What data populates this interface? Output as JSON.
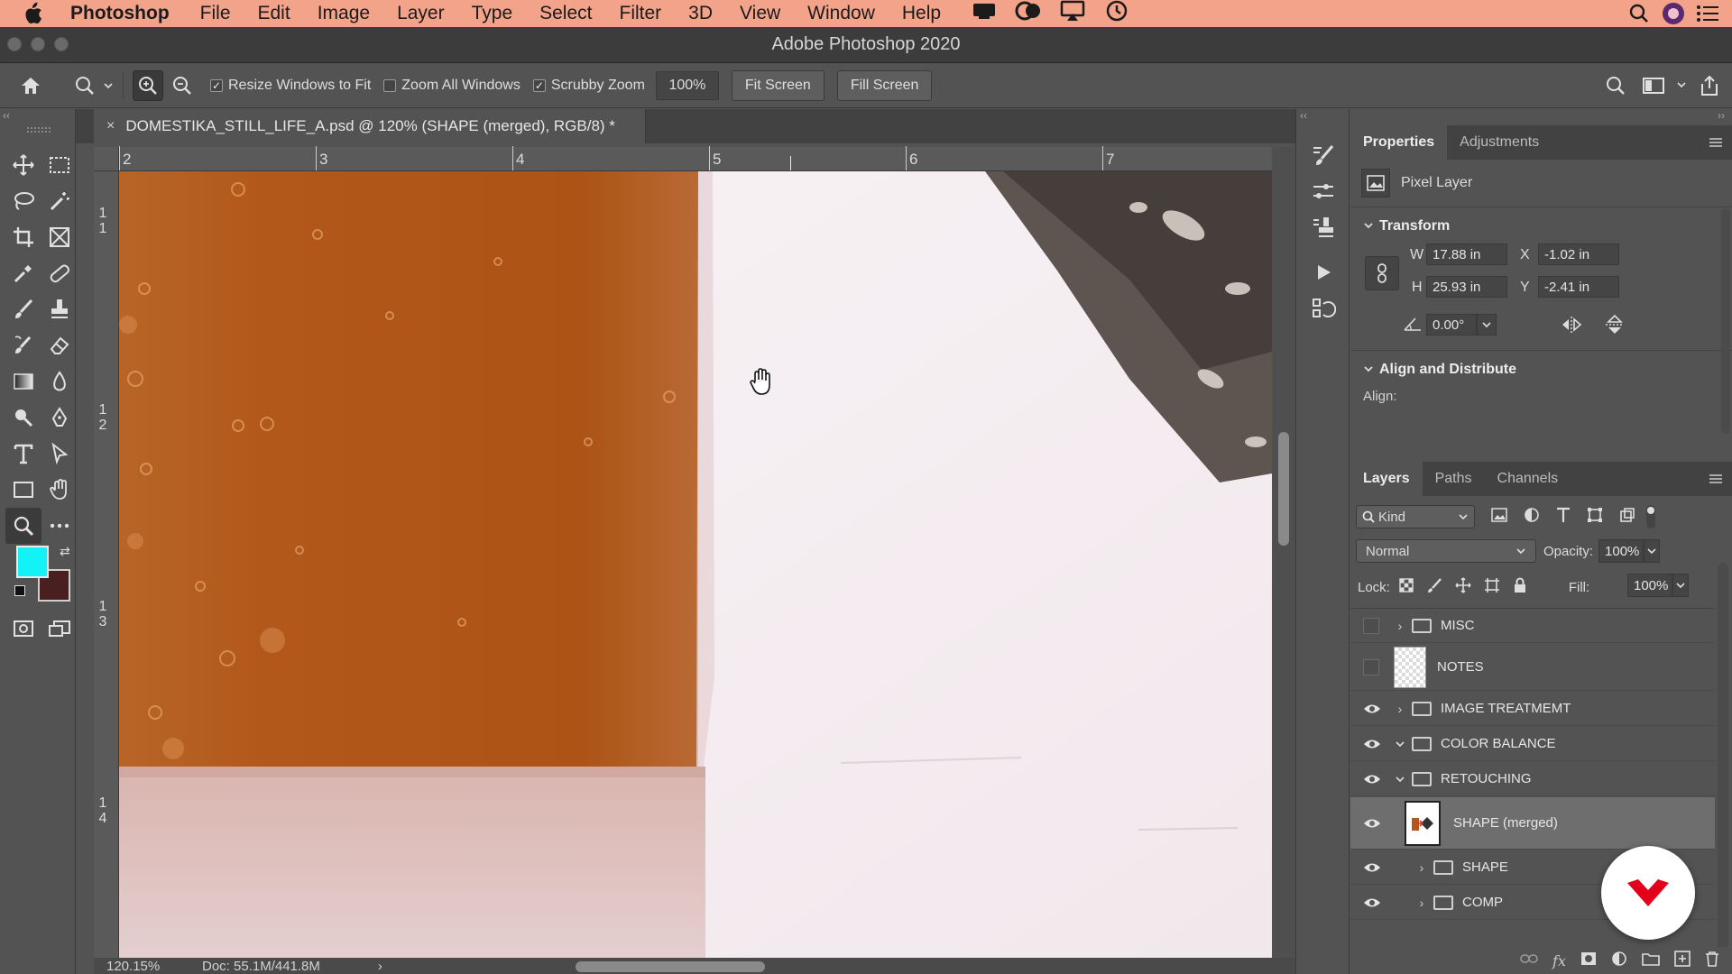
{
  "menubar": {
    "app_name": "Photoshop",
    "items": [
      "File",
      "Edit",
      "Image",
      "Layer",
      "Type",
      "Select",
      "Filter",
      "3D",
      "View",
      "Window",
      "Help"
    ]
  },
  "window": {
    "title": "Adobe Photoshop 2020"
  },
  "options": {
    "resize_windows": "Resize Windows to Fit",
    "zoom_all": "Zoom All Windows",
    "scrubby_zoom": "Scrubby Zoom",
    "zoom_value": "100%",
    "fit_screen": "Fit Screen",
    "fill_screen": "Fill Screen",
    "resize_checked": true,
    "zoom_all_checked": false,
    "scrubby_checked": true
  },
  "document": {
    "tab_title": "DOMESTIKA_STILL_LIFE_A.psd @ 120% (SHAPE (merged), RGB/8) *",
    "close": "×"
  },
  "rulers": {
    "top": [
      "2",
      "3",
      "4",
      "5",
      "6",
      "7"
    ],
    "left": [
      [
        "1",
        "1"
      ],
      [
        "1",
        "2"
      ],
      [
        "1",
        "3"
      ],
      [
        "1",
        "4"
      ]
    ]
  },
  "status": {
    "zoom": "120.15%",
    "doc": "Doc: 55.1M/441.8M",
    "arrow": "›"
  },
  "colors": {
    "foreground": "#13f2f7",
    "background": "#4a1f1f",
    "menubar": "#f3a38a"
  },
  "properties": {
    "tabs": [
      "Properties",
      "Adjustments"
    ],
    "layer_type": "Pixel Layer",
    "transform_title": "Transform",
    "w_label": "W",
    "w_value": "17.88 in",
    "h_label": "H",
    "h_value": "25.93 in",
    "x_label": "X",
    "x_value": "-1.02 in",
    "y_label": "Y",
    "y_value": "-2.41 in",
    "angle_value": "0.00°",
    "align_title": "Align and Distribute",
    "align_label": "Align:"
  },
  "layers": {
    "tabs": [
      "Layers",
      "Paths",
      "Channels"
    ],
    "filter_kind": "Kind",
    "blend_mode": "Normal",
    "opacity_label": "Opacity:",
    "opacity_value": "100%",
    "lock_label": "Lock:",
    "fill_label": "Fill:",
    "fill_value": "100%",
    "rows": [
      {
        "name": "MISC",
        "visible": false,
        "kind": "group",
        "open": false,
        "indent": 0
      },
      {
        "name": "NOTES",
        "visible": false,
        "kind": "pixel",
        "indent": 0
      },
      {
        "name": "IMAGE TREATMEMT",
        "visible": true,
        "kind": "group",
        "open": false,
        "indent": 0
      },
      {
        "name": "COLOR BALANCE",
        "visible": true,
        "kind": "group",
        "open": true,
        "indent": 0
      },
      {
        "name": "RETOUCHING",
        "visible": true,
        "kind": "group",
        "open": true,
        "indent": 0
      },
      {
        "name": "SHAPE (merged)",
        "visible": true,
        "kind": "smart",
        "indent": 1,
        "selected": true
      },
      {
        "name": "SHAPE",
        "visible": true,
        "kind": "group",
        "open": false,
        "indent": 1
      },
      {
        "name": "COMP",
        "visible": true,
        "kind": "group",
        "open": false,
        "indent": 1
      }
    ]
  }
}
